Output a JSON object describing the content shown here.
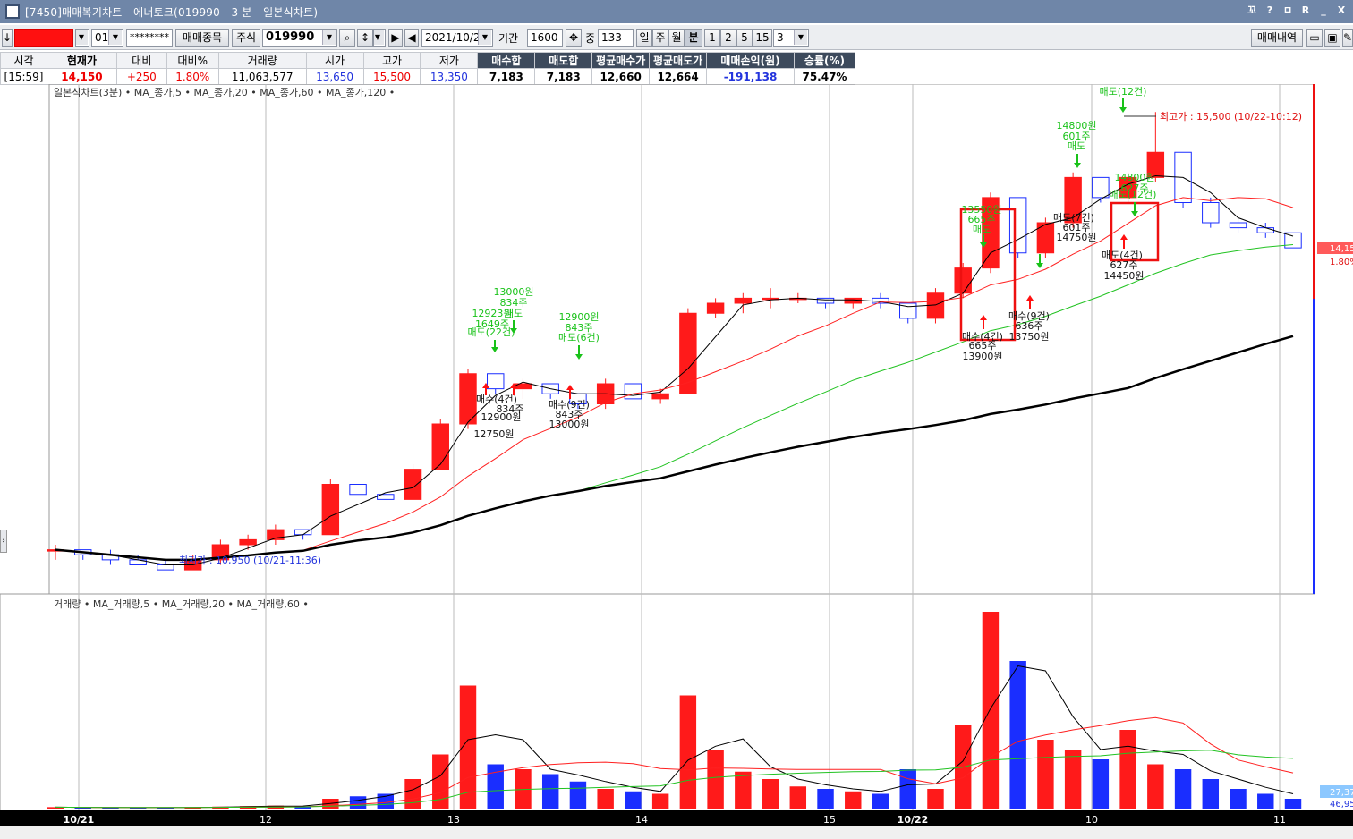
{
  "window": {
    "title": "[7450]매매복기차트 - 에너토크(019990 - 3 분 - 일본식차트)",
    "controls": [
      "꼬",
      "?",
      "ㅁ",
      "R",
      "_",
      "X"
    ]
  },
  "toolbar": {
    "account_value": "",
    "account_suffix": "01",
    "password_mask": "********",
    "trade_items_label": "매매종목",
    "market_label": "주식",
    "code_value": "019990",
    "date_value": "2021/10/22",
    "period_label": "기간",
    "period_value": "1600",
    "middle_label": "중",
    "count_value": "133",
    "unit_labels": [
      "일",
      "주",
      "월",
      "분"
    ],
    "minute_buttons": [
      "1",
      "2",
      "5",
      "15"
    ],
    "minute_value": "3",
    "trade_history_label": "매매내역"
  },
  "quote": {
    "headers": [
      "시각",
      "현재가",
      "대비",
      "대비%",
      "거래량",
      "시가",
      "고가",
      "저가",
      "매수합",
      "매도합",
      "평균매수가",
      "평균매도가",
      "매매손익(원)",
      "승률(%)"
    ],
    "values": [
      "[15:59]",
      "14,150",
      "+250",
      "1.80%",
      "11,063,577",
      "13,650",
      "15,500",
      "13,350",
      "7,183",
      "7,183",
      "12,660",
      "12,664",
      "-191,138",
      "75.47%"
    ]
  },
  "colors": {
    "up": "#ff1a1a",
    "down": "#1a2eff",
    "ma5": "#000000",
    "ma20": "#ff2020",
    "ma60": "#22c322",
    "ma120": "#000000",
    "sell_text": "#19c219",
    "buy_arrow": "#ff1010"
  },
  "price_panel": {
    "legend": "일본식차트(3분) • MA_종가,5 • MA_종가,20 • MA_종가,60 • MA_종가,120 •",
    "high_note": "최고가 : 15,500 (10/22-10:12)",
    "low_note": "최저가 : 10,950 (10/21-11:36)",
    "price_tag": "14,15",
    "pct_tag": "1.80%"
  },
  "volume_panel": {
    "legend": "거래량 • MA_거래량,5 • MA_거래량,20 • MA_거래량,60 •",
    "tag1": "27,37",
    "tag2": "46,95"
  },
  "x_labels": [
    "10/21",
    "12",
    "13",
    "14",
    "15",
    "10/22",
    "10",
    "11"
  ],
  "annotations": [
    {
      "text": "13000원",
      "color": "green"
    },
    {
      "text": "834주",
      "color": "green"
    },
    {
      "text": "12923원",
      "color": "green"
    },
    {
      "text": "1649주",
      "color": "green"
    },
    {
      "text": "매도",
      "color": "green"
    },
    {
      "text": "매도(22건)",
      "color": "green"
    },
    {
      "text": "12900원",
      "color": "green"
    },
    {
      "text": "843주",
      "color": "green"
    },
    {
      "text": "매도(6건)",
      "color": "green"
    },
    {
      "text": "매수(4건)",
      "color": "black"
    },
    {
      "text": "834주",
      "color": "black"
    },
    {
      "text": "12900원",
      "color": "black"
    },
    {
      "text": "12750원",
      "color": "black"
    },
    {
      "text": "매수(9건)",
      "color": "black"
    },
    {
      "text": "843주",
      "color": "black"
    },
    {
      "text": "13000원",
      "color": "black"
    },
    {
      "text": "13550원",
      "color": "green"
    },
    {
      "text": "665주",
      "color": "green"
    },
    {
      "text": "매도",
      "color": "green"
    },
    {
      "text": "매수(4건)",
      "color": "black"
    },
    {
      "text": "665주",
      "color": "black"
    },
    {
      "text": "13900원",
      "color": "black"
    },
    {
      "text": "14800원",
      "color": "green"
    },
    {
      "text": "601주",
      "color": "green"
    },
    {
      "text": "매도",
      "color": "green"
    },
    {
      "text": "매도(7건)",
      "color": "black"
    },
    {
      "text": "601주",
      "color": "black"
    },
    {
      "text": "14750원",
      "color": "black"
    },
    {
      "text": "매수(9건)",
      "color": "black"
    },
    {
      "text": "636주",
      "color": "black"
    },
    {
      "text": "13750원",
      "color": "black"
    },
    {
      "text": "매도(12건)",
      "color": "green"
    },
    {
      "text": "14800원",
      "color": "green"
    },
    {
      "text": "627주",
      "color": "green"
    },
    {
      "text": "매도(12건)",
      "color": "green"
    },
    {
      "text": "매도(4건)",
      "color": "black"
    },
    {
      "text": "627주",
      "color": "black"
    },
    {
      "text": "14450원",
      "color": "black"
    }
  ],
  "chart_data": {
    "type": "candlestick",
    "title": "",
    "series": [
      {
        "name": "MA_종가,5"
      },
      {
        "name": "MA_종가,20"
      },
      {
        "name": "MA_종가,60"
      },
      {
        "name": "MA_종가,120"
      }
    ],
    "y_range_estimate": [
      10800,
      15600
    ],
    "sessions": [
      "10/21",
      "12",
      "13",
      "14",
      "15",
      "10/22",
      "10",
      "11"
    ],
    "candles_approx": [
      [
        11150,
        11200,
        11050,
        11150
      ],
      [
        11150,
        11100,
        11050,
        11100
      ],
      [
        11100,
        11150,
        11000,
        11050
      ],
      [
        11050,
        11100,
        11000,
        11000
      ],
      [
        11000,
        11050,
        10950,
        10950
      ],
      [
        10950,
        11100,
        10950,
        11050
      ],
      [
        11050,
        11250,
        11000,
        11200
      ],
      [
        11200,
        11300,
        11150,
        11250
      ],
      [
        11250,
        11400,
        11200,
        11350
      ],
      [
        11350,
        11300,
        11250,
        11300
      ],
      [
        11300,
        11850,
        11300,
        11800
      ],
      [
        11800,
        11750,
        11700,
        11700
      ],
      [
        11700,
        11700,
        11650,
        11650
      ],
      [
        11650,
        12000,
        11650,
        11950
      ],
      [
        11950,
        12450,
        11950,
        12400
      ],
      [
        12400,
        12950,
        12350,
        12900
      ],
      [
        12900,
        12850,
        12700,
        12750
      ],
      [
        12750,
        12850,
        12650,
        12800
      ],
      [
        12800,
        12800,
        12650,
        12700
      ],
      [
        12700,
        12600,
        12550,
        12600
      ],
      [
        12600,
        12850,
        12550,
        12800
      ],
      [
        12800,
        12700,
        12650,
        12650
      ],
      [
        12650,
        12750,
        12600,
        12700
      ],
      [
        12700,
        13550,
        12700,
        13500
      ],
      [
        13500,
        13650,
        13450,
        13600
      ],
      [
        13600,
        13700,
        13500,
        13650
      ],
      [
        13650,
        13750,
        13550,
        13650
      ],
      [
        13650,
        13700,
        13600,
        13650
      ],
      [
        13650,
        13650,
        13550,
        13600
      ],
      [
        13600,
        13650,
        13550,
        13650
      ],
      [
        13650,
        13700,
        13550,
        13600
      ],
      [
        13600,
        13550,
        13400,
        13450
      ],
      [
        13450,
        13750,
        13400,
        13700
      ],
      [
        13700,
        14000,
        13650,
        13950
      ],
      [
        13950,
        14700,
        13900,
        14650
      ],
      [
        14650,
        14450,
        14050,
        14100
      ],
      [
        14100,
        14450,
        14050,
        14400
      ],
      [
        14400,
        14900,
        14350,
        14850
      ],
      [
        14850,
        14750,
        14600,
        14650
      ],
      [
        14650,
        14900,
        14600,
        14850
      ],
      [
        14850,
        15500,
        14800,
        15100
      ],
      [
        15100,
        14950,
        14550,
        14600
      ],
      [
        14600,
        14650,
        14350,
        14400
      ],
      [
        14400,
        14450,
        14300,
        14350
      ],
      [
        14350,
        14400,
        14250,
        14300
      ],
      [
        14300,
        14300,
        14150,
        14150
      ]
    ]
  }
}
